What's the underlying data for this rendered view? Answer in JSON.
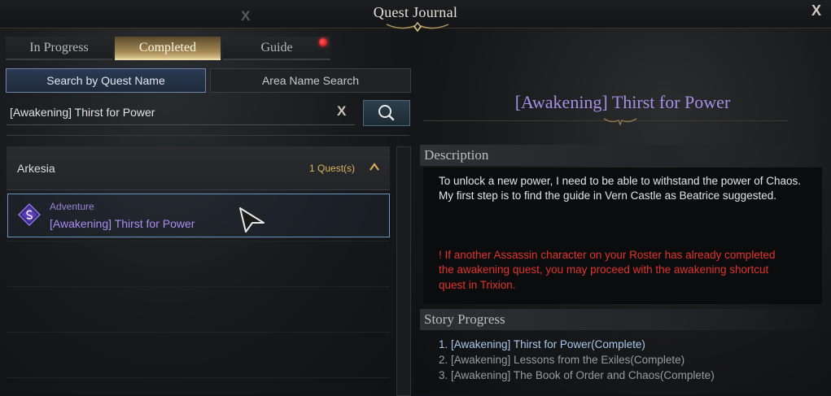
{
  "window": {
    "title": "Quest Journal"
  },
  "tabs": [
    {
      "label": "In Progress",
      "active": false
    },
    {
      "label": "Completed",
      "active": true
    },
    {
      "label": "Guide",
      "active": false,
      "has_notification": true
    }
  ],
  "search": {
    "mode_quest_name": "Search by Quest Name",
    "mode_area_name": "Area Name Search",
    "active_mode": "quest_name",
    "query": "[Awakening] Thirst for Power",
    "clear_label": "X"
  },
  "list": {
    "group": {
      "name": "Arkesia",
      "count_label": "1 Quest(s)",
      "expanded": true
    },
    "items": [
      {
        "category": "Adventure",
        "title": "[Awakening] Thirst for Power",
        "selected": true
      }
    ]
  },
  "detail": {
    "title": "[Awakening] Thirst for Power",
    "description_heading": "Description",
    "description_lines": [
      "To unlock a new power, I need to be able to withstand the power of Chaos.",
      "My first step is to find the guide in Vern Castle as Beatrice suggested."
    ],
    "warning": "! If another Assassin character on your Roster has already completed the awakening quest, you may proceed with the awakening shortcut quest in Trixion.",
    "story_heading": "Story Progress",
    "story_steps": [
      "1. [Awakening] Thirst for Power(Complete)",
      "2. [Awakening] Lessons from the Exiles(Complete)",
      "3. [Awakening] The Book of Order and Chaos(Complete)"
    ]
  },
  "colors": {
    "accent_gold": "#d9c38e",
    "quest_purple": "#a98ef0",
    "warning_red": "#e0342c",
    "story_current": "#a9c6ee"
  },
  "icons": {
    "close": "close-icon",
    "search": "search-icon",
    "chevron": "chevron-up-icon",
    "quest": "adventure-quest-icon",
    "notification": "notification-dot-icon"
  }
}
